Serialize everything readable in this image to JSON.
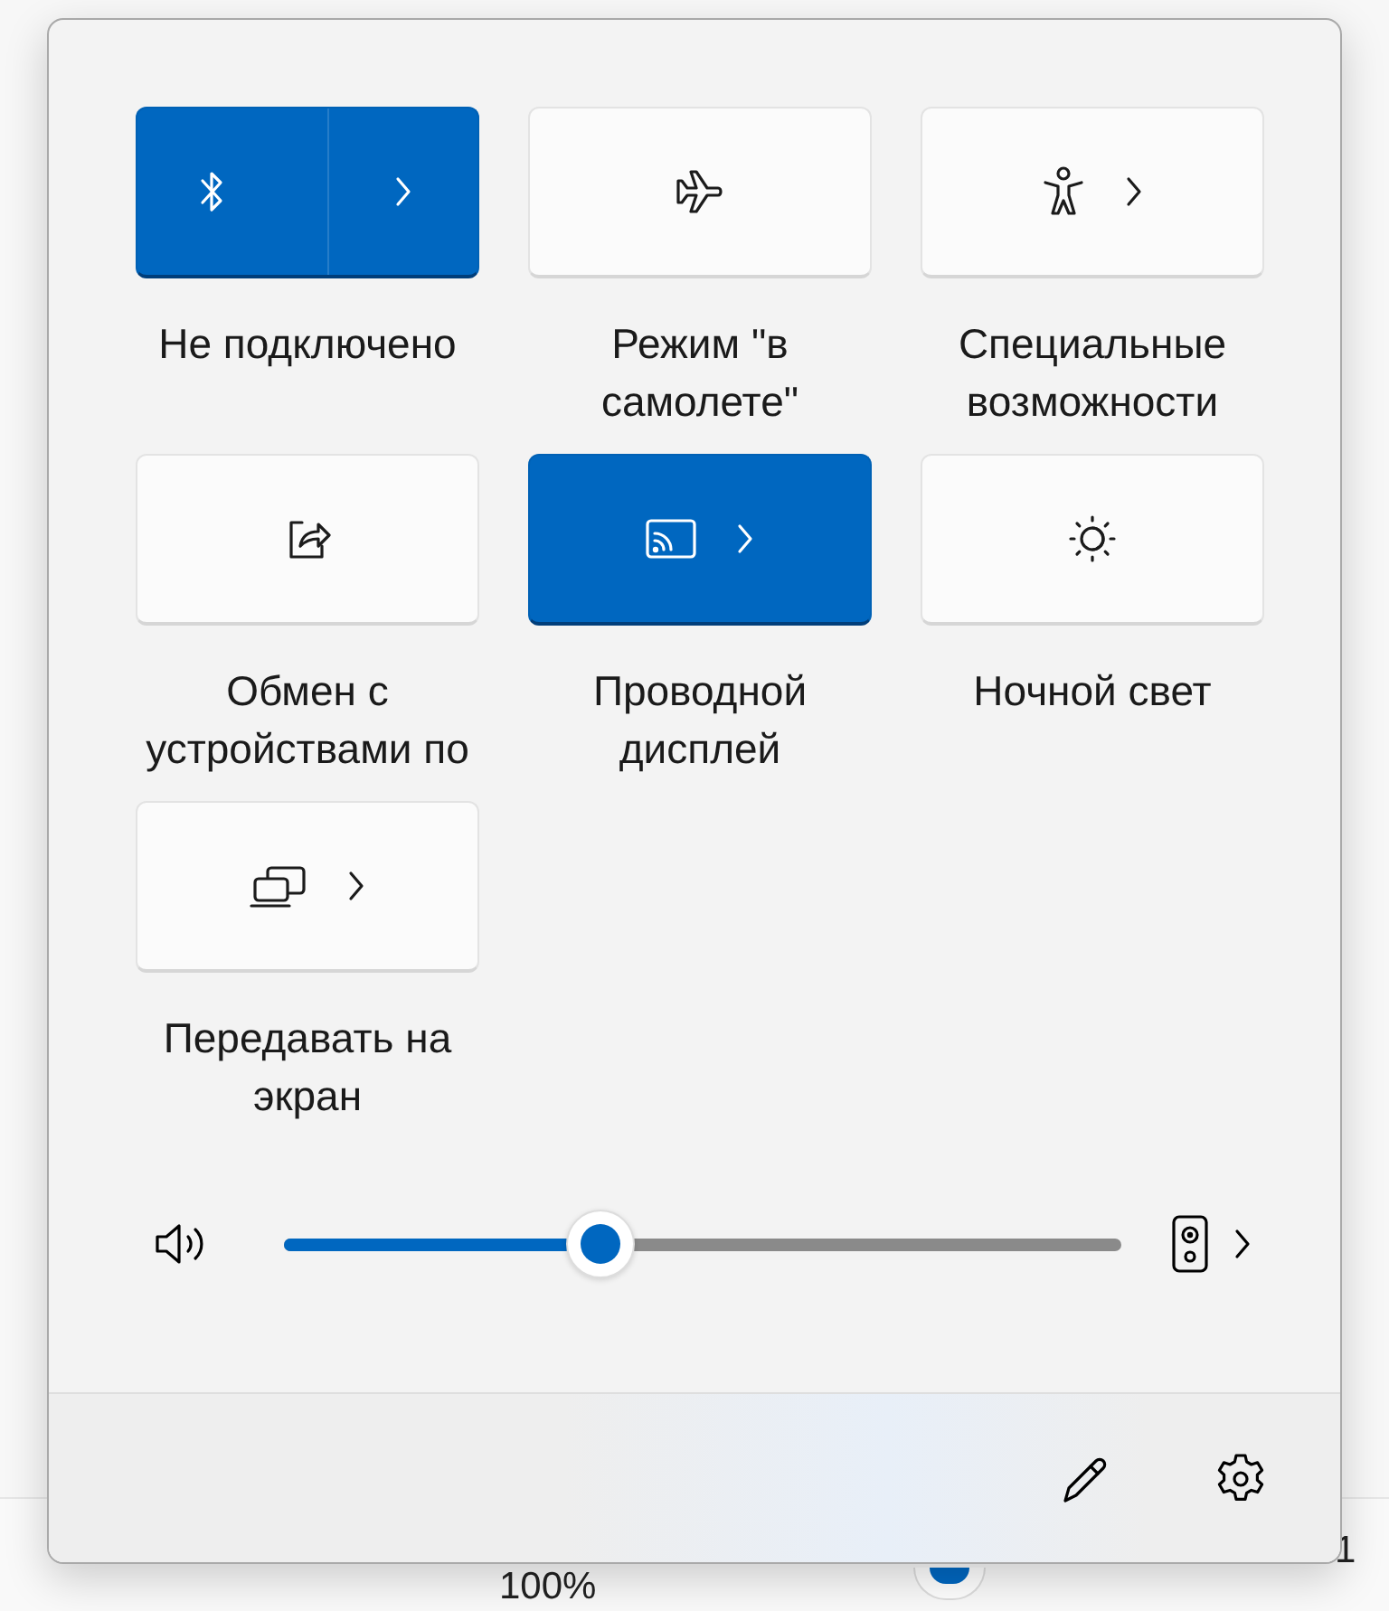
{
  "background_page": {
    "zoom_value": "100%",
    "cut_text": "1"
  },
  "tiles": [
    {
      "kind": "split",
      "label": "Не подключено",
      "on": true,
      "chevron": true
    },
    {
      "kind": "toggle",
      "label": "Режим \"в самолете\"",
      "on": false,
      "chevron": false
    },
    {
      "kind": "toggle",
      "label": "Специальные возможности",
      "on": false,
      "chevron": true
    },
    {
      "kind": "toggle",
      "label": "Обмен с устройствами по",
      "on": false,
      "chevron": false
    },
    {
      "kind": "toggle",
      "label": "Проводной дисплей",
      "on": true,
      "chevron": true
    },
    {
      "kind": "toggle",
      "label": "Ночной свет",
      "on": false,
      "chevron": false
    },
    {
      "kind": "toggle",
      "label": "Передавать на экран",
      "on": false,
      "chevron": true
    }
  ],
  "volume": {
    "level": 0.377
  }
}
